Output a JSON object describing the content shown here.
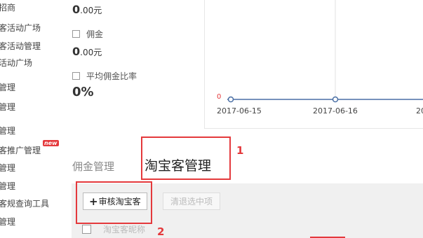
{
  "sidebar": {
    "items": [
      {
        "label": "招商"
      },
      {
        "label": "客活动广场"
      },
      {
        "label": "客活动管理"
      },
      {
        "label": "活动广场"
      },
      {
        "label": "管理"
      },
      {
        "label": "管理"
      },
      {
        "label": "管理"
      },
      {
        "label": "客推广管理"
      },
      {
        "label": "管理"
      },
      {
        "label": "管理"
      },
      {
        "label": "客规查询工具"
      },
      {
        "label": "管理"
      }
    ],
    "new_badge": "new"
  },
  "stats": {
    "value1_big": "0",
    "value1_small": ".00元",
    "commission_label": "佣金",
    "value2_big": "0",
    "value2_small": ".00元",
    "avg_rate_label": "平均佣金比率",
    "avg_rate_value": "0%"
  },
  "chart": {
    "zero_label": "0",
    "ticks": [
      "2017-06-15",
      "2017-06-16",
      "20"
    ],
    "line_color": "#4a6fa5"
  },
  "tabs": {
    "inactive": "佣金管理",
    "active": "淘宝客管理"
  },
  "toolbar": {
    "add_plus": "+",
    "add_label": "审核淘宝客",
    "clear_label": "清退选中项",
    "column_header": "淘宝客昵称"
  },
  "annotations": {
    "one": "1",
    "two": "2",
    "color": "#e4393c"
  }
}
